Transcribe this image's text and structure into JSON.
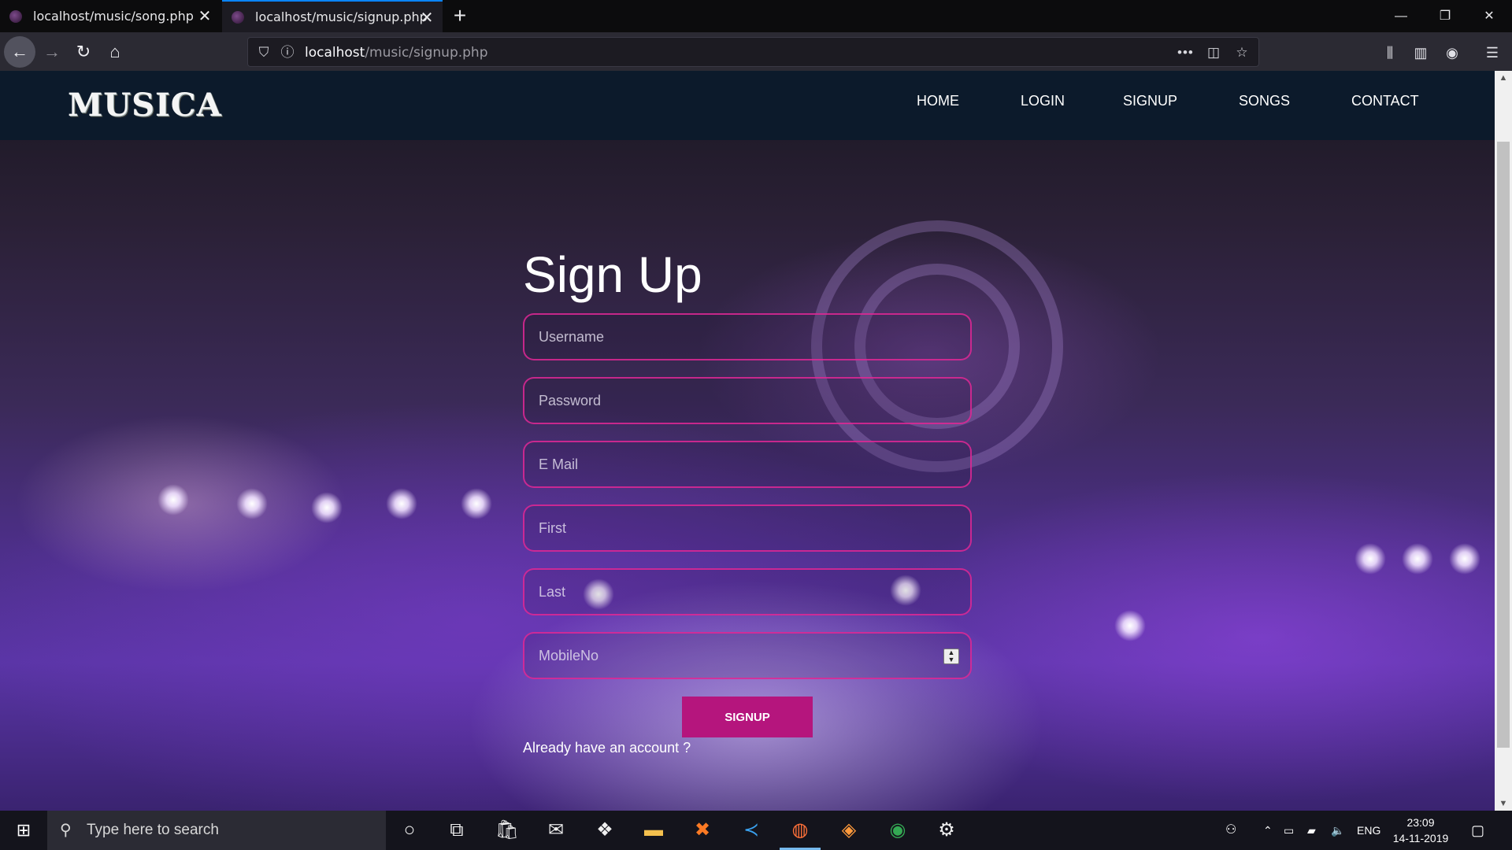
{
  "browser": {
    "tabs": [
      {
        "label": "localhost/music/song.php",
        "active": false
      },
      {
        "label": "localhost/music/signup.php",
        "active": true
      }
    ],
    "url_host": "localhost",
    "url_path": "/music/signup.php",
    "accent": "#0a84ff"
  },
  "site": {
    "logo": "MUSICA",
    "nav": [
      "HOME",
      "LOGIN",
      "SIGNUP",
      "SONGS",
      "CONTACT"
    ],
    "nav_bg": "#0c1a2b"
  },
  "form": {
    "title": "Sign Up",
    "fields": [
      {
        "placeholder": "Username"
      },
      {
        "placeholder": "Password"
      },
      {
        "placeholder": "E Mail"
      },
      {
        "placeholder": "First"
      },
      {
        "placeholder": "Last"
      },
      {
        "placeholder": "MobileNo"
      }
    ],
    "submit_label": "SIGNUP",
    "submit_color": "#b5157d",
    "login_prompt": "Already have an account ?"
  },
  "taskbar": {
    "search_placeholder": "Type here to search",
    "language": "ENG",
    "time": "23:09",
    "date": "14-11-2019"
  }
}
